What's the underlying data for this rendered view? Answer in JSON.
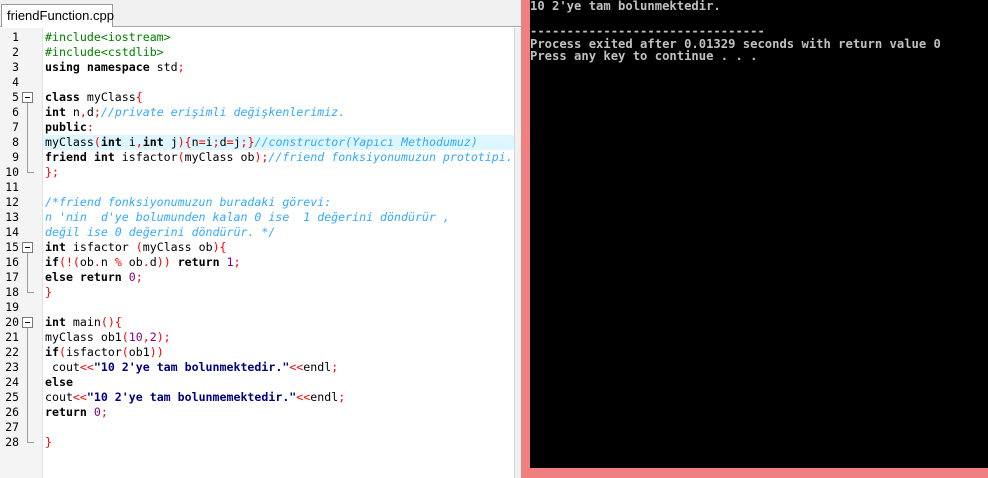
{
  "tab": {
    "filename": "friendFunction.cpp"
  },
  "icons": {
    "fold": "collapse-minus-icon"
  },
  "editor": {
    "highlight_color": "#ddf6ff",
    "lines": [
      {
        "n": "1",
        "fold": "",
        "tokens": [
          [
            "pp",
            "#include<iostream>"
          ]
        ]
      },
      {
        "n": "2",
        "fold": "",
        "tokens": [
          [
            "pp",
            "#include<cstdlib>"
          ]
        ]
      },
      {
        "n": "3",
        "fold": "",
        "tokens": [
          [
            "kw",
            "using namespace"
          ],
          [
            "tx",
            " std"
          ],
          [
            "op",
            ";"
          ]
        ]
      },
      {
        "n": "4",
        "fold": "",
        "tokens": []
      },
      {
        "n": "5",
        "fold": "start",
        "tokens": [
          [
            "kw",
            "class"
          ],
          [
            "tx",
            " myClass"
          ],
          [
            "op",
            "{"
          ]
        ]
      },
      {
        "n": "6",
        "fold": "line",
        "tokens": [
          [
            "kw",
            "int"
          ],
          [
            "tx",
            " n"
          ],
          [
            "op",
            ","
          ],
          [
            "tx",
            "d"
          ],
          [
            "op",
            ";"
          ],
          [
            "cm",
            "//private erişimli değişkenlerimiz."
          ]
        ]
      },
      {
        "n": "7",
        "fold": "line",
        "tokens": [
          [
            "kw",
            "public"
          ],
          [
            "op",
            ":"
          ]
        ]
      },
      {
        "n": "8",
        "fold": "line",
        "tokens": [
          [
            "tx",
            "myClass"
          ],
          [
            "op",
            "("
          ],
          [
            "kw",
            "int"
          ],
          [
            "tx",
            " i"
          ],
          [
            "op",
            ","
          ],
          [
            "kw",
            "int"
          ],
          [
            "tx",
            " j"
          ],
          [
            "op",
            ")"
          ],
          [
            "op",
            "{"
          ],
          [
            "tx",
            "n"
          ],
          [
            "op",
            "="
          ],
          [
            "tx",
            "i"
          ],
          [
            "op",
            ";"
          ],
          [
            "tx",
            "d"
          ],
          [
            "op",
            "="
          ],
          [
            "tx",
            "j"
          ],
          [
            "op",
            ";}"
          ],
          [
            "cm",
            "//constructor(Yapıcı Methodumuz)"
          ]
        ]
      },
      {
        "n": "9",
        "fold": "line",
        "tokens": [
          [
            "kw",
            "friend int"
          ],
          [
            "tx",
            " isfactor"
          ],
          [
            "op",
            "("
          ],
          [
            "tx",
            "myClass ob"
          ],
          [
            "op",
            ");"
          ],
          [
            "cm",
            "//friend fonksiyonumuzun prototipi."
          ]
        ]
      },
      {
        "n": "10",
        "fold": "end",
        "tokens": [
          [
            "op",
            "};"
          ]
        ]
      },
      {
        "n": "11",
        "fold": "",
        "tokens": []
      },
      {
        "n": "12",
        "fold": "",
        "tokens": [
          [
            "cm",
            "/*friend fonksiyonumuzun buradaki görevi:"
          ]
        ]
      },
      {
        "n": "13",
        "fold": "",
        "tokens": [
          [
            "cm",
            "n 'nin  d'ye bolumunden kalan 0 ise  1 değerini döndürür ,"
          ]
        ]
      },
      {
        "n": "14",
        "fold": "",
        "tokens": [
          [
            "cm",
            "değil ise 0 değerini döndürür. */"
          ]
        ]
      },
      {
        "n": "15",
        "fold": "start",
        "tokens": [
          [
            "kw",
            "int"
          ],
          [
            "tx",
            " isfactor "
          ],
          [
            "op",
            "("
          ],
          [
            "tx",
            "myClass ob"
          ],
          [
            "op",
            ")"
          ],
          [
            "op",
            "{"
          ]
        ]
      },
      {
        "n": "16",
        "fold": "line",
        "tokens": [
          [
            "kw",
            "if"
          ],
          [
            "op",
            "(!("
          ],
          [
            "tx",
            "ob"
          ],
          [
            "op",
            "."
          ],
          [
            "tx",
            "n "
          ],
          [
            "op",
            "%"
          ],
          [
            "tx",
            " ob"
          ],
          [
            "op",
            "."
          ],
          [
            "tx",
            "d"
          ],
          [
            "op",
            "))"
          ],
          [
            "kw",
            " return"
          ],
          [
            "nm",
            " 1"
          ],
          [
            "op",
            ";"
          ]
        ]
      },
      {
        "n": "17",
        "fold": "line",
        "tokens": [
          [
            "kw",
            "else return"
          ],
          [
            "nm",
            " 0"
          ],
          [
            "op",
            ";"
          ]
        ]
      },
      {
        "n": "18",
        "fold": "end",
        "tokens": [
          [
            "op",
            "}"
          ]
        ]
      },
      {
        "n": "19",
        "fold": "",
        "tokens": []
      },
      {
        "n": "20",
        "fold": "start",
        "tokens": [
          [
            "kw",
            "int"
          ],
          [
            "tx",
            " main"
          ],
          [
            "op",
            "(){"
          ]
        ]
      },
      {
        "n": "21",
        "fold": "line",
        "tokens": [
          [
            "tx",
            "myClass ob1"
          ],
          [
            "op",
            "("
          ],
          [
            "nm",
            "10"
          ],
          [
            "op",
            ","
          ],
          [
            "nm",
            "2"
          ],
          [
            "op",
            ");"
          ]
        ]
      },
      {
        "n": "22",
        "fold": "line",
        "tokens": [
          [
            "kw",
            "if"
          ],
          [
            "op",
            "("
          ],
          [
            "tx",
            "isfactor"
          ],
          [
            "op",
            "("
          ],
          [
            "tx",
            "ob1"
          ],
          [
            "op",
            "))"
          ]
        ]
      },
      {
        "n": "23",
        "fold": "line",
        "tokens": [
          [
            "tx",
            " cout"
          ],
          [
            "op",
            "<<"
          ],
          [
            "st",
            "\"10 2'ye tam bolunmektedir.\""
          ],
          [
            "op",
            "<<"
          ],
          [
            "tx",
            "endl"
          ],
          [
            "op",
            ";"
          ]
        ]
      },
      {
        "n": "24",
        "fold": "line",
        "tokens": [
          [
            "kw",
            "else"
          ]
        ]
      },
      {
        "n": "25",
        "fold": "line",
        "tokens": [
          [
            "tx",
            "cout"
          ],
          [
            "op",
            "<<"
          ],
          [
            "st",
            "\"10 2'ye tam bolunmemektedir.\""
          ],
          [
            "op",
            "<<"
          ],
          [
            "tx",
            "endl"
          ],
          [
            "op",
            ";"
          ]
        ]
      },
      {
        "n": "26",
        "fold": "line",
        "tokens": [
          [
            "kw",
            "return"
          ],
          [
            "nm",
            " 0"
          ],
          [
            "op",
            ";"
          ]
        ]
      },
      {
        "n": "27",
        "fold": "line",
        "tokens": []
      },
      {
        "n": "28",
        "fold": "end",
        "tokens": [
          [
            "op",
            "}"
          ]
        ]
      }
    ]
  },
  "console": {
    "border_color": "#f08080",
    "lines": [
      "10 2'ye tam bolunmektedir.",
      "",
      "--------------------------------",
      "Process exited after 0.01329 seconds with return value 0",
      "Press any key to continue . . ."
    ]
  }
}
